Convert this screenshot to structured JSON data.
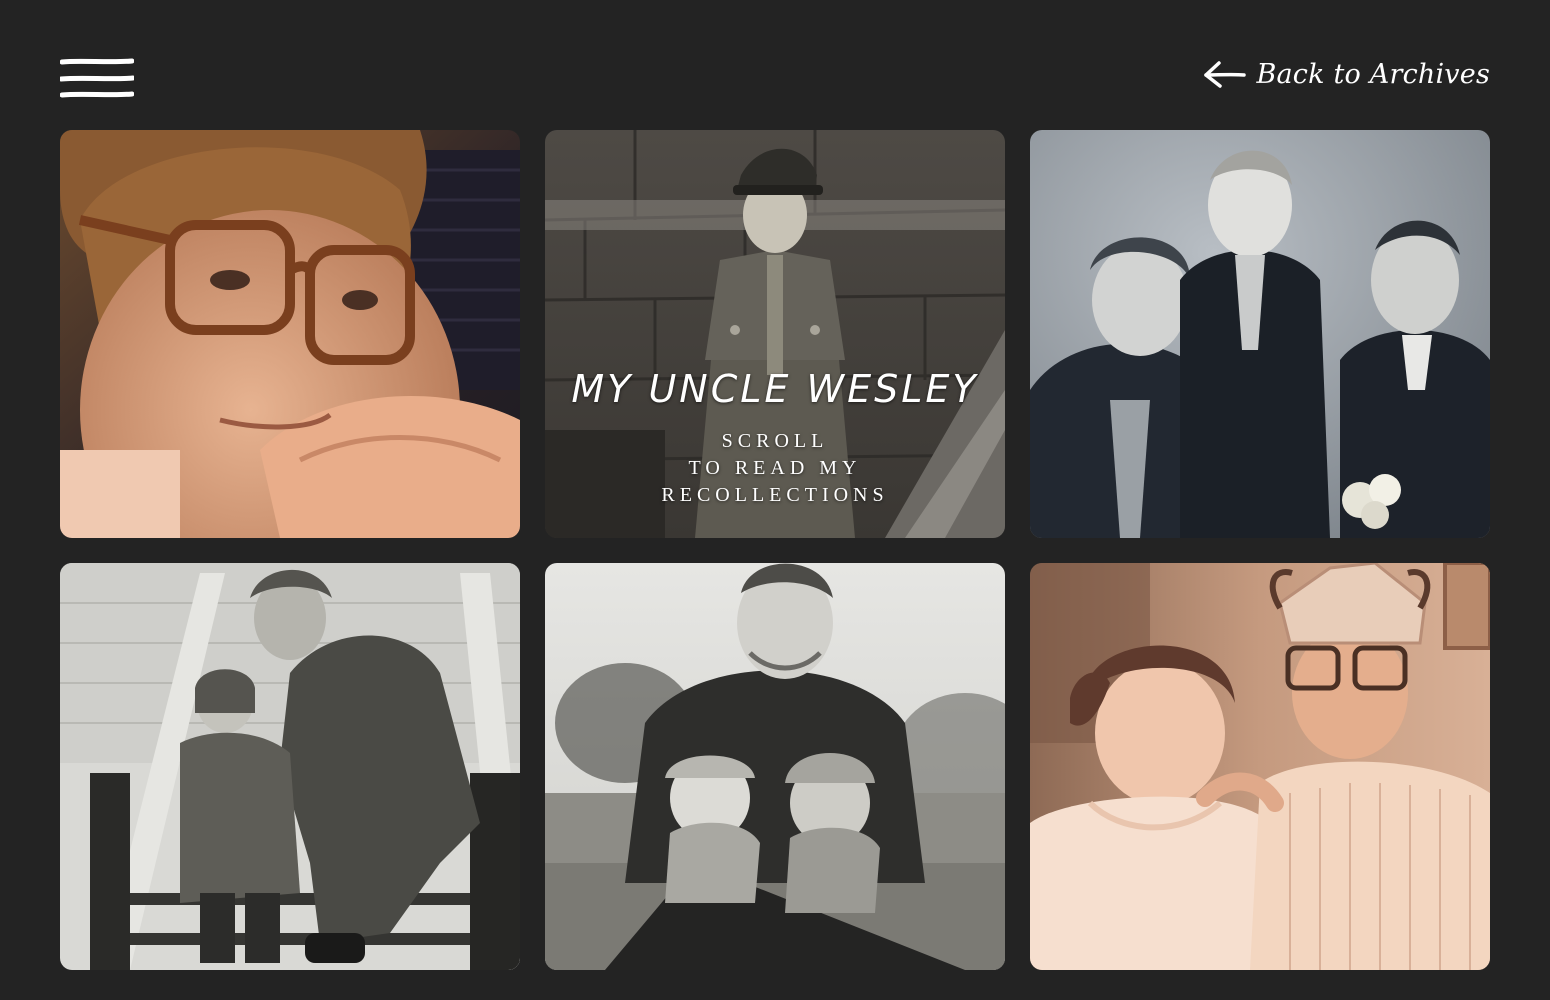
{
  "header": {
    "menu_icon": "hamburger-menu-icon",
    "back_link": {
      "label": "Back to Archives",
      "icon": "arrow-left-icon"
    }
  },
  "hero": {
    "title": "MY UNCLE WESLEY",
    "scroll_hint": [
      "SCROLL",
      "TO READ MY",
      "RECOLLECTIONS"
    ]
  },
  "colors": {
    "background": "#232323",
    "text": "#ffffff"
  }
}
